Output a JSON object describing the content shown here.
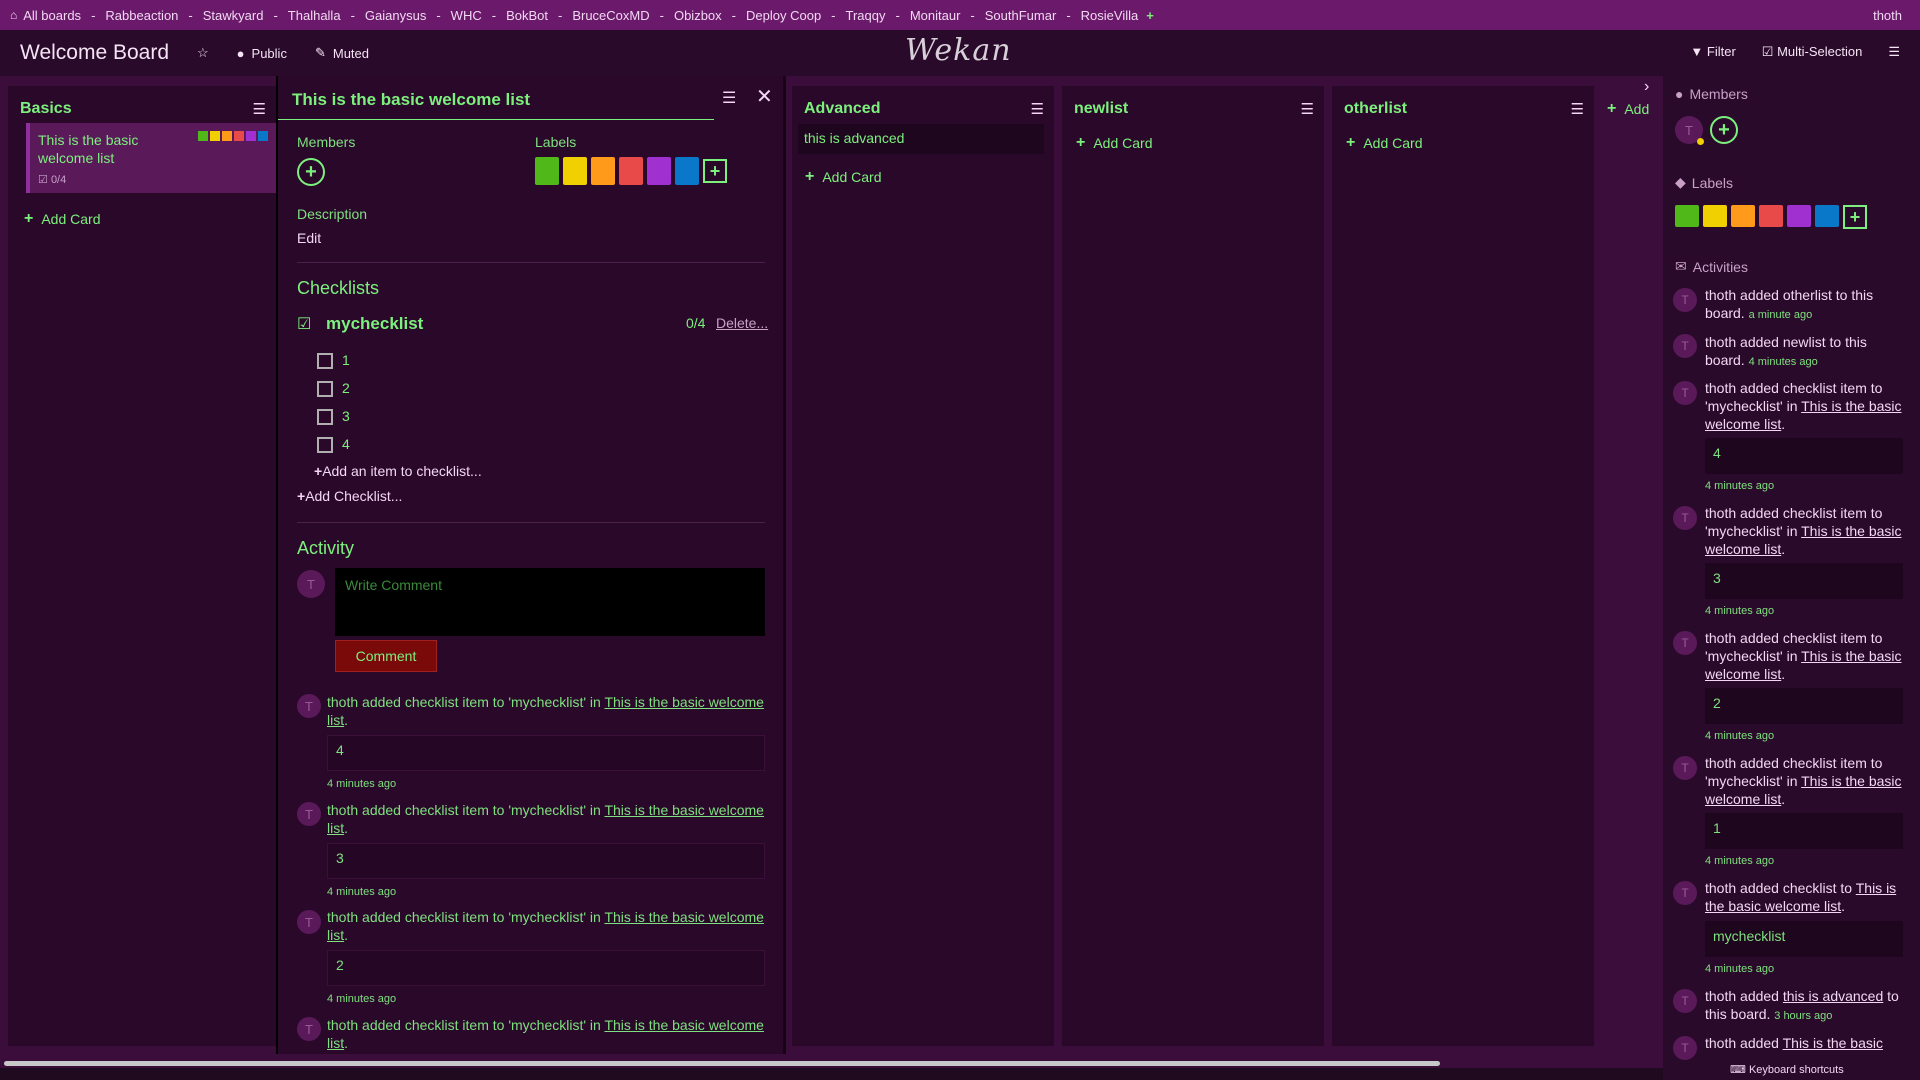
{
  "top_bar": {
    "all_boards": "All boards",
    "boards": [
      "Rabbeaction",
      "Stawkyard",
      "Thalhalla",
      "Gaianysus",
      "WHC",
      "BokBot",
      "BruceCoxMD",
      "Obizbox",
      "Deploy Coop",
      "Traqqy",
      "Monitaur",
      "SouthFumar",
      "RosieVilla"
    ],
    "user": "thoth"
  },
  "header": {
    "title": "Welcome Board",
    "visibility": "Public",
    "watch": "Muted",
    "logo": "Wekan",
    "filter": "Filter",
    "multi_selection": "Multi-Selection"
  },
  "lists": {
    "basics": {
      "title": "Basics",
      "card_title": "This is the basic welcome list",
      "card_checklist": "0/4",
      "add_card": "Add Card"
    },
    "advanced": {
      "title": "Advanced",
      "card_title": "this is advanced",
      "add_card": "Add Card"
    },
    "newlist": {
      "title": "newlist",
      "add_card": "Add Card"
    },
    "otherlist": {
      "title": "otherlist",
      "add_card": "Add Card"
    },
    "add_list": "Add L"
  },
  "label_colors": [
    "#51b81a",
    "#f0d000",
    "#ff9a1a",
    "#e84a4a",
    "#a030d0",
    "#0a78c8"
  ],
  "details": {
    "title": "This is the basic welcome list",
    "members_label": "Members",
    "labels_label": "Labels",
    "description_label": "Description",
    "description_edit": "Edit",
    "checklists_heading": "Checklists",
    "checklist": {
      "title": "mychecklist",
      "progress": "0/4",
      "delete": "Delete...",
      "items": [
        "1",
        "2",
        "3",
        "4"
      ],
      "add_item": "Add an item to checklist...",
      "add_checklist": "Add Checklist..."
    },
    "activity_heading": "Activity",
    "comment_placeholder": "Write Comment",
    "comment_button": "Comment",
    "activity": [
      {
        "prefix": "thoth added checklist item to 'mychecklist' in ",
        "link": "This is the basic welcome list",
        "suffix": ".",
        "quote": "4",
        "time": "4 minutes ago"
      },
      {
        "prefix": "thoth added checklist item to 'mychecklist' in ",
        "link": "This is the basic welcome list",
        "suffix": ".",
        "quote": "3",
        "time": "4 minutes ago"
      },
      {
        "prefix": "thoth added checklist item to 'mychecklist' in ",
        "link": "This is the basic welcome list",
        "suffix": ".",
        "quote": "2",
        "time": "4 minutes ago"
      },
      {
        "prefix": "thoth added checklist item to 'mychecklist' in ",
        "link": "This is the basic welcome list",
        "suffix": ".",
        "quote": "",
        "time": ""
      }
    ]
  },
  "sidebar": {
    "members_heading": "Members",
    "labels_heading": "Labels",
    "activities_heading": "Activities",
    "activities": [
      {
        "text": "thoth added otherlist to this board.",
        "time": "a minute ago"
      },
      {
        "text": "thoth added newlist to this board.",
        "time": "4 minutes ago"
      },
      {
        "text": "thoth added checklist item to 'mychecklist' in ",
        "link": "This is the basic welcome list",
        "quote": "4",
        "time": "4 minutes ago"
      },
      {
        "text": "thoth added checklist item to 'mychecklist' in ",
        "link": "This is the basic welcome list",
        "quote": "3",
        "time": "4 minutes ago"
      },
      {
        "text": "thoth added checklist item to 'mychecklist' in ",
        "link": "This is the basic welcome list",
        "quote": "2",
        "time": "4 minutes ago"
      },
      {
        "text": "thoth added checklist item to 'mychecklist' in ",
        "link": "This is the basic welcome list",
        "quote": "1",
        "time": "4 minutes ago"
      },
      {
        "text": "thoth added checklist to ",
        "link": "This is the basic welcome list",
        "quote": "mychecklist",
        "time": "4 minutes ago"
      },
      {
        "text": "thoth added ",
        "link": "this is advanced",
        "suffix": " to this board.",
        "time": "3 hours ago"
      },
      {
        "text": "thoth added ",
        "link": "This is the basic"
      }
    ],
    "keyboard_shortcuts": "Keyboard shortcuts"
  }
}
